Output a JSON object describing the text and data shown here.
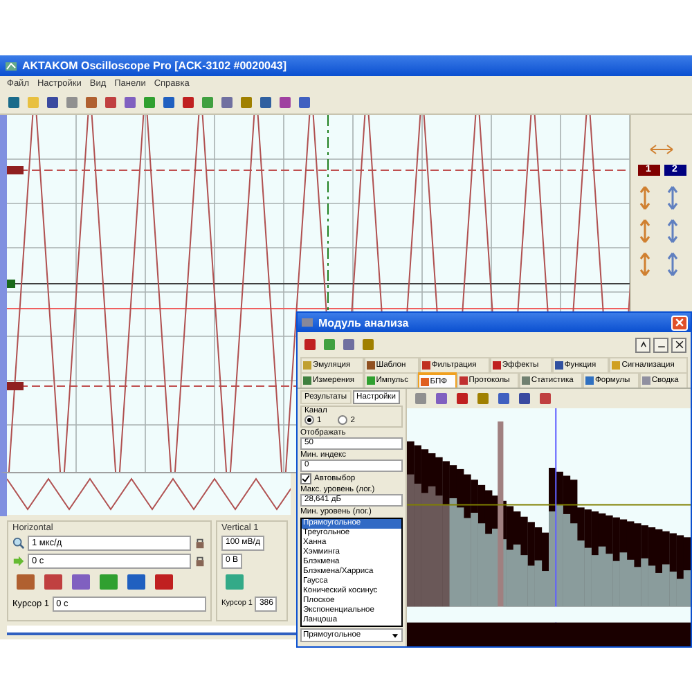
{
  "window": {
    "title": "AKTAKOM Oscilloscope Pro [ACK-3102 #0020043]"
  },
  "menu": [
    "Файл",
    "Настройки",
    "Вид",
    "Панели",
    "Справка"
  ],
  "channel_badges": [
    {
      "label": "1",
      "color": "#800000"
    },
    {
      "label": "2",
      "color": "#000080"
    }
  ],
  "horizontal": {
    "title": "Horizontal",
    "scale": "1 мкс/д",
    "offset": "0 с",
    "cursor_label": "Курсор 1",
    "cursor_value": "0 с"
  },
  "vertical": {
    "title": "Vertical 1",
    "scale": "100 мВ/д",
    "offset": "0 В",
    "cursor_label": "Курсор 1",
    "cursor_value": "386"
  },
  "analysis": {
    "title": "Модуль анализа",
    "tabs_row1": [
      {
        "label": "Эмуляция",
        "selected": false
      },
      {
        "label": "Шаблон",
        "selected": false
      },
      {
        "label": "Фильтрация",
        "selected": false
      },
      {
        "label": "Эффекты",
        "selected": false
      },
      {
        "label": "Функция",
        "selected": false
      },
      {
        "label": "Сигнализация",
        "selected": false
      }
    ],
    "tabs_row2": [
      {
        "label": "Измерения",
        "selected": false
      },
      {
        "label": "Импульс",
        "selected": false
      },
      {
        "label": "БПФ",
        "selected": true
      },
      {
        "label": "Протоколы",
        "selected": false
      },
      {
        "label": "Статистика",
        "selected": false
      },
      {
        "label": "Формулы",
        "selected": false
      },
      {
        "label": "Сводка",
        "selected": false
      }
    ],
    "subtabs": [
      {
        "label": "Результаты",
        "selected": false
      },
      {
        "label": "Настройки",
        "selected": true
      }
    ],
    "channel_label": "Канал",
    "channels": [
      {
        "label": "1",
        "selected": true
      },
      {
        "label": "2",
        "selected": false
      }
    ],
    "fields": [
      {
        "label": "Отображать",
        "value": "50"
      },
      {
        "label": "Мин. индекс",
        "value": "0"
      }
    ],
    "autoselect": {
      "label": "Автовыбор",
      "checked": true
    },
    "max_level": {
      "label": "Макс. уровень (лог.)",
      "value": "28,641 дБ"
    },
    "min_level_label": "Мин. уровень (лог.)",
    "window_options": [
      {
        "label": "Прямоугольное",
        "selected": true
      },
      {
        "label": "Треугольное",
        "selected": false
      },
      {
        "label": "Ханна",
        "selected": false
      },
      {
        "label": "Хэмминга",
        "selected": false
      },
      {
        "label": "Блэкмена",
        "selected": false
      },
      {
        "label": "Блэкмена/Харриса",
        "selected": false
      },
      {
        "label": "Гаусса",
        "selected": false
      },
      {
        "label": "Конический косинус",
        "selected": false
      },
      {
        "label": "Плоское",
        "selected": false
      },
      {
        "label": "Экспоненциальное",
        "selected": false
      },
      {
        "label": "Ланцоша",
        "selected": false
      }
    ],
    "window_value": "Прямоугольное"
  }
}
